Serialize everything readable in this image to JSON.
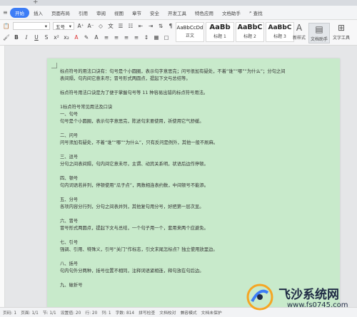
{
  "menubar": {
    "items": [
      "开始",
      "插入",
      "页面布局",
      "引用",
      "审阅",
      "视图",
      "章节",
      "安全",
      "开发工具",
      "特色应用",
      "文档助手"
    ],
    "search_label": "查找"
  },
  "toolbar": {
    "font_name": "",
    "font_size": "五号",
    "paste_label": "",
    "styles": [
      {
        "sample": "AaBbCcDd",
        "name": "正文"
      },
      {
        "sample": "AaBb",
        "name": "标题 1"
      },
      {
        "sample": "AaBbC",
        "name": "标题 2"
      },
      {
        "sample": "AaBbC",
        "name": "标题 3"
      }
    ],
    "new_style_label": "新样式",
    "doc_assistant_label": "文档助手",
    "text_tool_label": "文字工具"
  },
  "document": {
    "lines": [
      "标点符号的用法口诀有：句号是个小圆圈，表示句字意思完；问号很加有疑处，不着“谁”“哪”“为什么”；分句之间",
      "表间隔，句内间它意未尽；冒号形式两圆点，提起下文与总结等。",
      "",
      "标点符号用法口诀是为了便于掌握句号等 11 种容易出错的标点符号用法。",
      "",
      "1标点符号常见用法及口诀",
      "一、句号",
      "句号是个小圆圈，表示句字意思完，陈述句末要使用，祈使用它气舒缓。",
      "",
      "二、问号",
      "问号须加有疑处，不着“谁”“哪”“为什么”，只有反问是例外，其他一般不厕麻。",
      "",
      "三、逗号",
      "分句之间表间隔，句内间它意未尽，主谓、动宾关系明，状语后边作停顿。",
      "",
      "四、顿号",
      "句内词语若并列，停顿使用“瓜子点”，两数相连表约数，中间顿号不能添。",
      "",
      "五、分号",
      "各项内容分行列，分句之间表并列，其他复句用分号，好把第一层次显。",
      "",
      "六、冒号",
      "冒号形式两圆点，提起下文与总结，一个句子用一个，套用来两个应避免。",
      "",
      "七、引号",
      "强调、引用、特殊义，引号“关门”作标志，引文末尾怎标点？独立使用放里边。",
      "",
      "八、括号",
      "句内句外分两种，括号位置不相同，注释词语紧相连，释句放在句后边。",
      "",
      "九、破折号"
    ]
  },
  "statusbar": {
    "page": "页码: 1",
    "pages": "页面: 1/1",
    "section": "节: 1/1",
    "set_value": "设置值: 20",
    "row": "行: 20",
    "col": "列: 1",
    "words": "字数: 814",
    "spell_check": "拼写检查",
    "doc_check": "文档校对",
    "compat_mode": "兼容模式",
    "protected": "文档未保护"
  },
  "watermark": {
    "text": "飞沙系统网",
    "url": "www.fs0745.com"
  }
}
